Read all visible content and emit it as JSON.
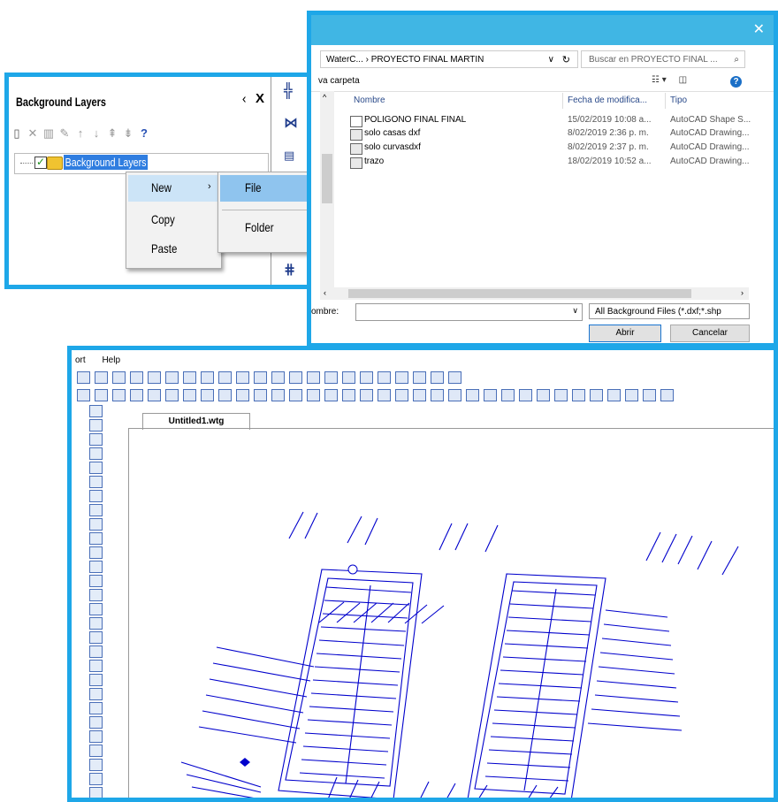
{
  "background_layers": {
    "title": "Background Layers",
    "pin_icon": "pin-icon",
    "close_label": "X",
    "tree_root_label": "Background Layers",
    "context_menu": {
      "items": [
        "New",
        "Copy",
        "Paste"
      ]
    },
    "submenu": {
      "items": [
        "File",
        "Folder"
      ]
    }
  },
  "file_dialog": {
    "close_label": "✕",
    "breadcrumb": "WaterC...  ›  PROYECTO FINAL MARTIN",
    "search_placeholder": "Buscar en PROYECTO FINAL ...",
    "new_folder": "va carpeta",
    "columns": [
      "Nombre",
      "Fecha de modifica...",
      "Tipo"
    ],
    "files": [
      {
        "name": "POLIGONO FINAL FINAL",
        "date": "15/02/2019 10:08 a...",
        "type": "AutoCAD Shape S..."
      },
      {
        "name": "solo casas dxf",
        "date": "8/02/2019 2:36 p. m.",
        "type": "AutoCAD Drawing..."
      },
      {
        "name": "solo curvasdxf",
        "date": "8/02/2019 2:37 p. m.",
        "type": "AutoCAD Drawing..."
      },
      {
        "name": "trazo",
        "date": "18/02/2019 10:52 a...",
        "type": "AutoCAD Drawing..."
      }
    ],
    "filename_label": "ombre:",
    "filter": "All Background Files (*.dxf;*.shp",
    "open_button": "Abrir",
    "cancel_button": "Cancelar"
  },
  "main_app": {
    "menu": [
      "ort",
      "Help"
    ],
    "tab_title": "Untitled1.wtg"
  },
  "colors": {
    "frame": "#1ea7e8",
    "drawing": "#0000cc",
    "selection": "#2f7de0"
  }
}
